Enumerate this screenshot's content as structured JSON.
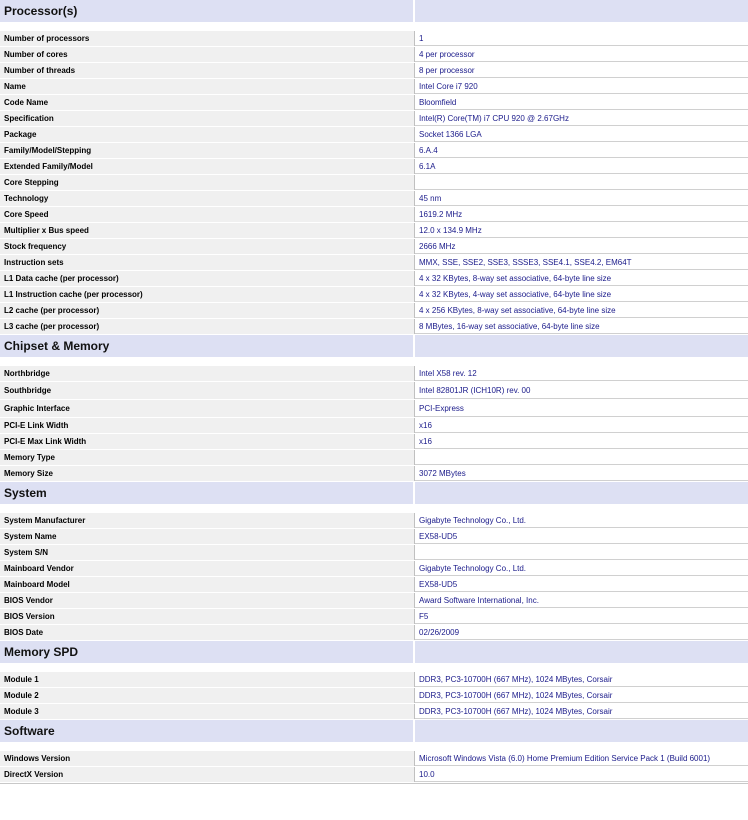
{
  "sections": [
    {
      "title": "Processor(s)",
      "rows": [
        {
          "label": "Number of processors",
          "value": "1"
        },
        {
          "label": "Number of cores",
          "value": "4 per processor"
        },
        {
          "label": "Number of threads",
          "value": "8 per processor"
        },
        {
          "label": "Name",
          "value": "Intel Core i7 920"
        },
        {
          "label": "Code Name",
          "value": "Bloomfield"
        },
        {
          "label": "Specification",
          "value": "Intel(R) Core(TM) i7 CPU 920 @ 2.67GHz"
        },
        {
          "label": "Package",
          "value": "Socket 1366 LGA"
        },
        {
          "label": "Family/Model/Stepping",
          "value": "6.A.4"
        },
        {
          "label": "Extended Family/Model",
          "value": "6.1A"
        },
        {
          "label": "Core Stepping",
          "value": ""
        },
        {
          "label": "Technology",
          "value": "45 nm"
        },
        {
          "label": "Core Speed",
          "value": "1619.2 MHz"
        },
        {
          "label": "Multiplier x Bus speed",
          "value": "12.0 x 134.9 MHz"
        },
        {
          "label": "Stock frequency",
          "value": "2666 MHz"
        },
        {
          "label": "Instruction sets",
          "value": "MMX, SSE, SSE2, SSE3, SSSE3, SSE4.1, SSE4.2, EM64T"
        },
        {
          "label": "L1 Data cache (per processor)",
          "value": "4 x 32 KBytes, 8-way set associative, 64-byte line size"
        },
        {
          "label": "L1 Instruction cache (per processor)",
          "value": "4 x 32 KBytes, 4-way set associative, 64-byte line size"
        },
        {
          "label": "L2 cache (per processor)",
          "value": "4 x 256 KBytes, 8-way set associative, 64-byte line size"
        },
        {
          "label": "L3 cache (per processor)",
          "value": "8 MBytes, 16-way set associative, 64-byte line size"
        }
      ]
    },
    {
      "title": "Chipset & Memory",
      "rows": [
        {
          "label": "Northbridge",
          "value": "Intel X58 rev. 12"
        },
        {
          "label": "Southbridge",
          "value": "Intel 82801JR (ICH10R) rev. 00"
        },
        {
          "label": "Graphic Interface",
          "value": "PCI-Express"
        },
        {
          "label": "PCI-E Link Width",
          "value": "x16"
        },
        {
          "label": "PCI-E Max Link Width",
          "value": "x16"
        },
        {
          "label": "Memory Type",
          "value": ""
        },
        {
          "label": "Memory Size",
          "value": "3072 MBytes"
        }
      ]
    },
    {
      "title": "System",
      "rows": [
        {
          "label": "System Manufacturer",
          "value": "Gigabyte Technology Co., Ltd."
        },
        {
          "label": "System Name",
          "value": "EX58-UD5"
        },
        {
          "label": "System S/N",
          "value": ""
        },
        {
          "label": "Mainboard Vendor",
          "value": "Gigabyte Technology Co., Ltd."
        },
        {
          "label": "Mainboard Model",
          "value": "EX58-UD5"
        },
        {
          "label": "BIOS Vendor",
          "value": "Award Software International, Inc."
        },
        {
          "label": "BIOS Version",
          "value": "F5"
        },
        {
          "label": "BIOS Date",
          "value": "02/26/2009"
        }
      ]
    },
    {
      "title": "Memory SPD",
      "rows": [
        {
          "label": "Module 1",
          "value": "DDR3, PC3-10700H (667 MHz), 1024 MBytes, Corsair"
        },
        {
          "label": "Module 2",
          "value": "DDR3, PC3-10700H (667 MHz), 1024 MBytes, Corsair"
        },
        {
          "label": "Module 3",
          "value": "DDR3, PC3-10700H (667 MHz), 1024 MBytes, Corsair"
        }
      ]
    },
    {
      "title": "Software",
      "rows": [
        {
          "label": "Windows Version",
          "value": "Microsoft Windows Vista (6.0) Home Premium Edition Service Pack 1 (Build 6001)"
        },
        {
          "label": "DirectX Version",
          "value": "10.0"
        }
      ]
    }
  ],
  "colors": {
    "section_header_bg": "#dde0f3",
    "label_bg": "#f0f0f0",
    "value_text": "#1a1a8a"
  }
}
